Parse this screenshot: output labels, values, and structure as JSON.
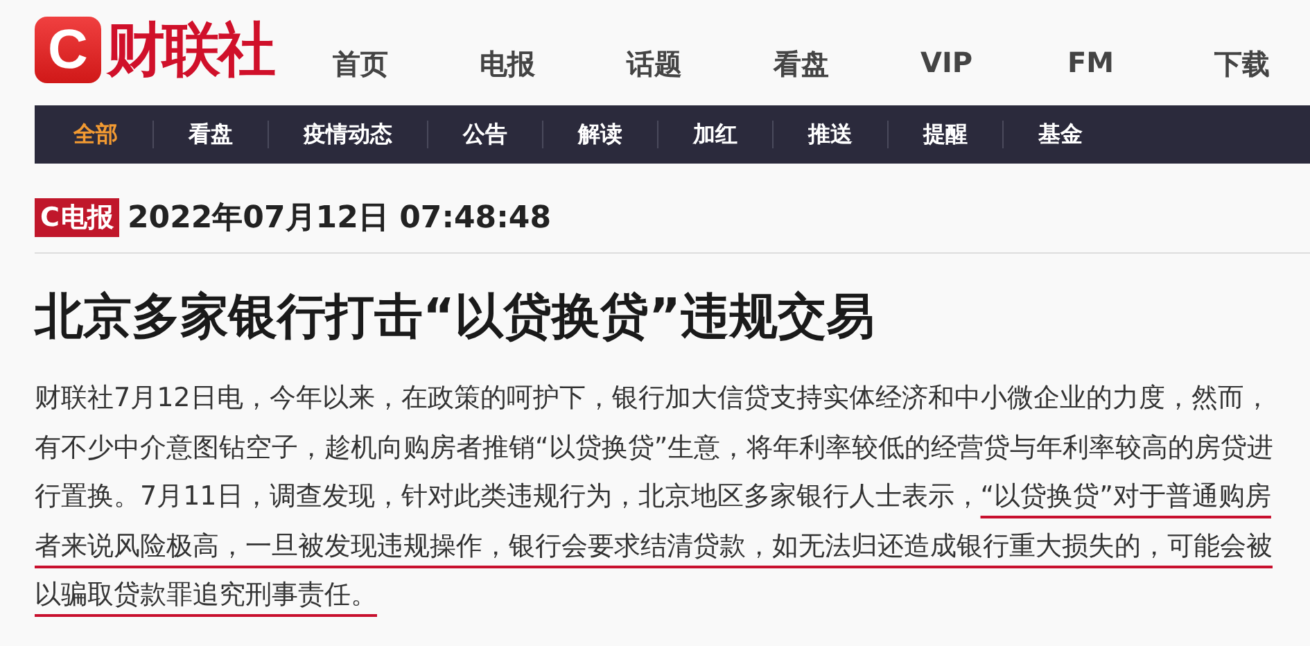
{
  "logo": {
    "mark": "C",
    "name": "财联社"
  },
  "top_nav": [
    "首页",
    "电报",
    "话题",
    "看盘",
    "VIP",
    "FM",
    "下载"
  ],
  "category_tabs": [
    {
      "label": "全部",
      "selected": true
    },
    {
      "label": "看盘",
      "selected": false
    },
    {
      "label": "疫情动态",
      "selected": false
    },
    {
      "label": "公告",
      "selected": false
    },
    {
      "label": "解读",
      "selected": false
    },
    {
      "label": "加红",
      "selected": false
    },
    {
      "label": "推送",
      "selected": false
    },
    {
      "label": "提醒",
      "selected": false
    },
    {
      "label": "基金",
      "selected": false
    }
  ],
  "badge": {
    "mark": "C",
    "label": "电报"
  },
  "timestamp": "2022年07月12日 07:48:48",
  "headline": "北京多家银行打击“以贷换贷”违规交易",
  "body": {
    "text": "财联社7月12日电，今年以来，在政策的呵护下，银行加大信贷支持实体经济和中小微企业的力度，然而，有不少中介意图钻空子，趁机向购房者推销“以贷换贷”生意，将年利率较低的经营贷与年利率较高的房贷进行置换。7月11日，调查发现，针对此类违规行为，北京地区多家银行人士表示，",
    "underlined": "“以贷换贷”对于普通购房者来说风险极高，一旦被发现违规操作，银行会要求结清贷款，如无法归还造成银行重大损失的，可能会被以骗取贷款罪追究刑事责任。"
  }
}
